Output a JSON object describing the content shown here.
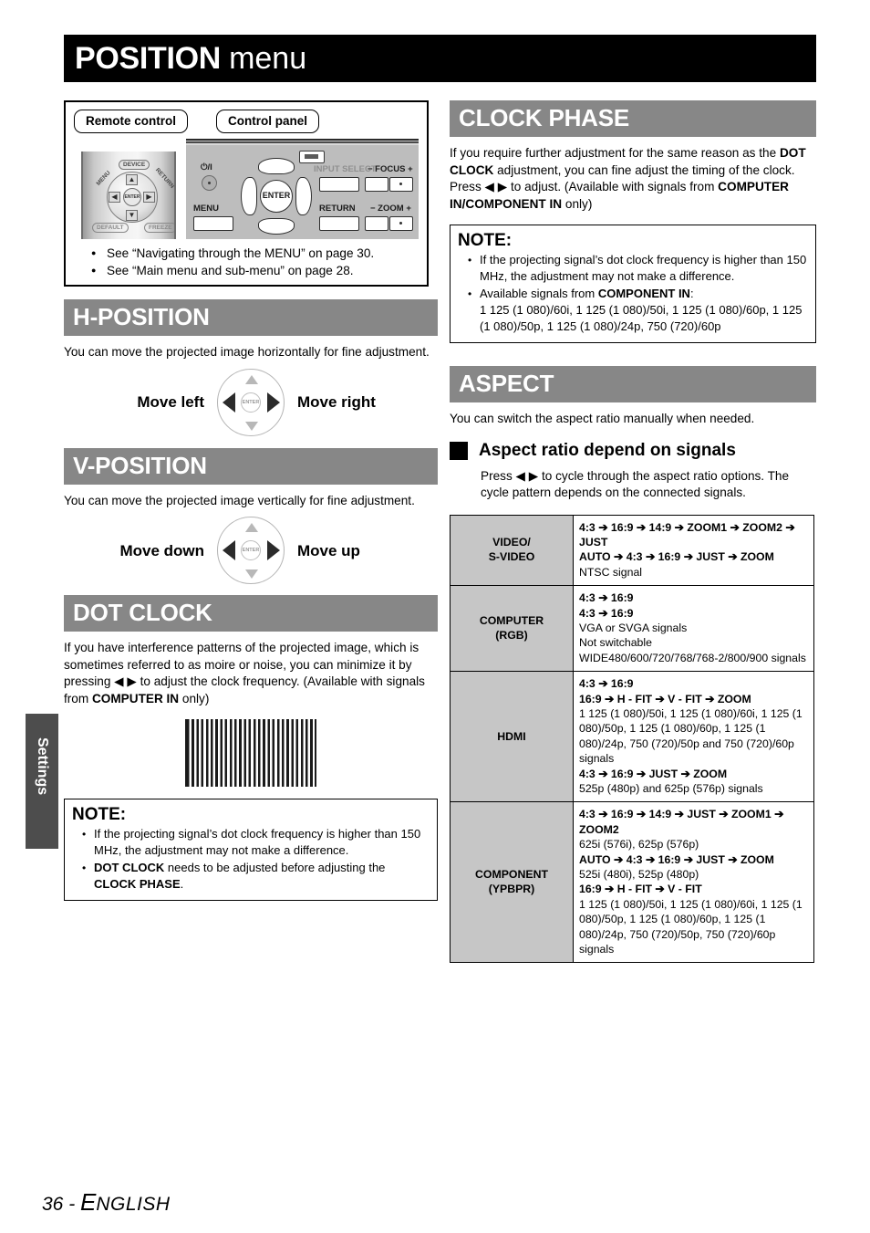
{
  "page": {
    "title_bold": "POSITION",
    "title_normal": "menu",
    "side_tab": "Settings",
    "footer_page": "36 - ",
    "footer_lang_cap": "E",
    "footer_lang_rest": "NGLISH"
  },
  "controls_box": {
    "remote_label": "Remote control",
    "panel_label": "Control panel",
    "remote": {
      "menu": "MENU",
      "device": "DEVICE",
      "return": "RETURN",
      "default": "DEFAULT",
      "freeze": "FREEZE",
      "enter": "ENTER",
      "up": "▲",
      "down": "▼",
      "left": "◀",
      "right": "▶"
    },
    "panel": {
      "power": "⏻/I",
      "enter": "ENTER",
      "menu": "MENU",
      "return": "RETURN",
      "input_select": "INPUT SELECT",
      "focus": "−  FOCUS  +",
      "zoom": "−  ZOOM  +"
    },
    "see_items": [
      "See “Navigating through the MENU” on page 30.",
      "See “Main menu and sub-menu” on page 28."
    ]
  },
  "h_position": {
    "heading": "H-POSITION",
    "body": "You can move the projected image horizontally for fine adjustment.",
    "caption_left": "Move left",
    "caption_right": "Move right",
    "enter_label": "ENTER"
  },
  "v_position": {
    "heading": "V-POSITION",
    "body": "You can move the projected image vertically for fine adjustment.",
    "caption_left": "Move down",
    "caption_right": "Move up",
    "enter_label": "ENTER"
  },
  "dot_clock": {
    "heading": "DOT CLOCK",
    "body_1": "If you have interference patterns of the projected image, which is sometimes referred to as moire or noise, you can minimize it by pressing ",
    "arrows": "◀ ▶",
    "body_2": " to adjust the clock frequency. (Available with signals from ",
    "body_bold": "COMPUTER IN",
    "body_3": " only)",
    "note_title": "NOTE:",
    "note_1": "If the projecting signal’s dot clock frequency is higher than 150 MHz, the adjustment may not make a difference.",
    "note_2_b1": "DOT CLOCK",
    "note_2_mid": " needs to be adjusted before adjusting the ",
    "note_2_b2": "CLOCK PHASE",
    "note_2_end": "."
  },
  "clock_phase": {
    "heading": "CLOCK PHASE",
    "body_1": "If you require further adjustment for the same reason as the ",
    "body_b1": "DOT CLOCK",
    "body_2": " adjustment, you can fine adjust the timing of the clock. Press ",
    "arrows": "◀ ▶",
    "body_3": " to adjust. (Available with signals from ",
    "body_b2": "COMPUTER IN/COMPONENT IN",
    "body_4": " only)",
    "note_title": "NOTE:",
    "note_1": "If the projecting signal’s dot clock frequency is higher than 150 MHz, the adjustment may not make a difference.",
    "note_2_pre": "Available signals from ",
    "note_2_b": "COMPONENT IN",
    "note_2_colon": ":",
    "note_2_signals": "1 125 (1 080)/60i, 1 125 (1 080)/50i, 1 125 (1 080)/60p, 1 125 (1 080)/50p, 1 125 (1 080)/24p, 750 (720)/60p"
  },
  "aspect": {
    "heading": "ASPECT",
    "body": "You can switch the aspect ratio manually when needed.",
    "sub_heading": "Aspect ratio depend on signals",
    "sub_body_1": "Press ",
    "sub_arrows": "◀ ▶",
    "sub_body_2": " to cycle through the aspect ratio options. The cycle pattern depends on the connected signals.",
    "table": [
      {
        "signal": "VIDEO/\nS-VIDEO",
        "lines": [
          {
            "text": "4:3 ➔ 16:9 ➔ 14:9 ➔ ZOOM1 ➔ ZOOM2 ➔ JUST",
            "bold": true
          },
          {
            "text": "AUTO ➔ 4:3 ➔ 16:9 ➔ JUST ➔ ZOOM",
            "bold": true
          },
          {
            "text": "NTSC signal",
            "bold": false
          }
        ]
      },
      {
        "signal": "COMPUTER\n(RGB)",
        "lines": [
          {
            "text": "4:3 ➔ 16:9",
            "bold": true
          },
          {
            "text": "4:3 ➔ 16:9",
            "bold": true
          },
          {
            "text": "VGA or SVGA signals",
            "bold": false
          },
          {
            "text": "Not switchable",
            "bold": false
          },
          {
            "text": "WIDE480/600/720/768/768-2/800/900 signals",
            "bold": false
          }
        ]
      },
      {
        "signal": "HDMI",
        "lines": [
          {
            "text": "4:3 ➔ 16:9",
            "bold": true
          },
          {
            "text": "16:9 ➔ H - FIT ➔ V - FIT ➔ ZOOM",
            "bold": true
          },
          {
            "text": "1 125 (1 080)/50i, 1 125 (1 080)/60i, 1 125 (1 080)/50p, 1 125 (1 080)/60p, 1 125 (1 080)/24p, 750 (720)/50p and 750 (720)/60p signals",
            "bold": false
          },
          {
            "text": "4:3 ➔ 16:9 ➔ JUST ➔ ZOOM",
            "bold": true
          },
          {
            "text": "525p (480p) and 625p (576p) signals",
            "bold": false
          }
        ]
      },
      {
        "signal": "COMPONENT\n(YPBPR)",
        "lines": [
          {
            "text": "4:3 ➔ 16:9 ➔ 14:9 ➔ JUST ➔ ZOOM1 ➔ ZOOM2",
            "bold": true
          },
          {
            "text": "625i (576i), 625p (576p)",
            "bold": false
          },
          {
            "text": "AUTO ➔ 4:3 ➔ 16:9 ➔ JUST ➔ ZOOM",
            "bold": true
          },
          {
            "text": "525i (480i), 525p (480p)",
            "bold": false
          },
          {
            "text": " 16:9 ➔ H - FIT ➔ V - FIT",
            "bold": true
          },
          {
            "text": "1 125 (1 080)/50i, 1 125 (1 080)/60i, 1 125 (1 080)/50p, 1 125 (1 080)/60p, 1 125 (1 080)/24p, 750 (720)/50p, 750 (720)/60p signals",
            "bold": false
          }
        ]
      }
    ]
  }
}
